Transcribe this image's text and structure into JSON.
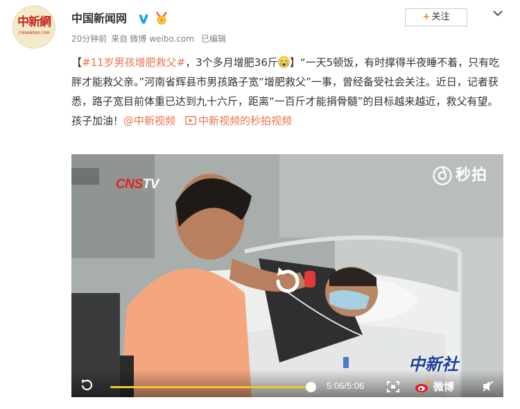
{
  "account": {
    "name": "中国新闻网",
    "avatar_text": "中新網",
    "avatar_sub": "CHINANEWS.COM",
    "verified_icon": "verified-v-icon",
    "medal_icon": "medal-icon"
  },
  "meta": {
    "time": "20分钟前",
    "source_prefix": "来自",
    "source_app": "微博",
    "source_domain": "weibo.com",
    "edited": "已编辑"
  },
  "follow_button": {
    "plus": "+",
    "label": "关注"
  },
  "post": {
    "bracket_open": "【",
    "hashtag": "#11岁男孩增肥救父#",
    "headline_rest": "，3个多月增肥36斤",
    "bracket_close": "】",
    "body": "“一天5顿饭，有时撑得半夜睡不着，只有吃胖才能救父亲。”河南省辉县市男孩路子宽“增肥救父”一事，曾经备受社会关注。近日，记者获悉，路子宽目前体重已达到九十六斤，距离“一百斤才能捐骨髓”的目标越来越近，救父有望。孩子加油！",
    "mention": "@中新视频",
    "video_link": "中新视频的秒拍视频"
  },
  "video": {
    "logo_cns": "CNS",
    "logo_tv": "TV",
    "watermark_top": "秒拍",
    "watermark_bottom": "中新社",
    "elapsed": "5:06",
    "duration": "5:06",
    "progress": 1.0,
    "platform_label": "微博"
  },
  "colors": {
    "link": "#eb7350",
    "accent_orange": "#ff8200",
    "progress": "#f4c230",
    "verified_blue": "#1aa3f0"
  }
}
